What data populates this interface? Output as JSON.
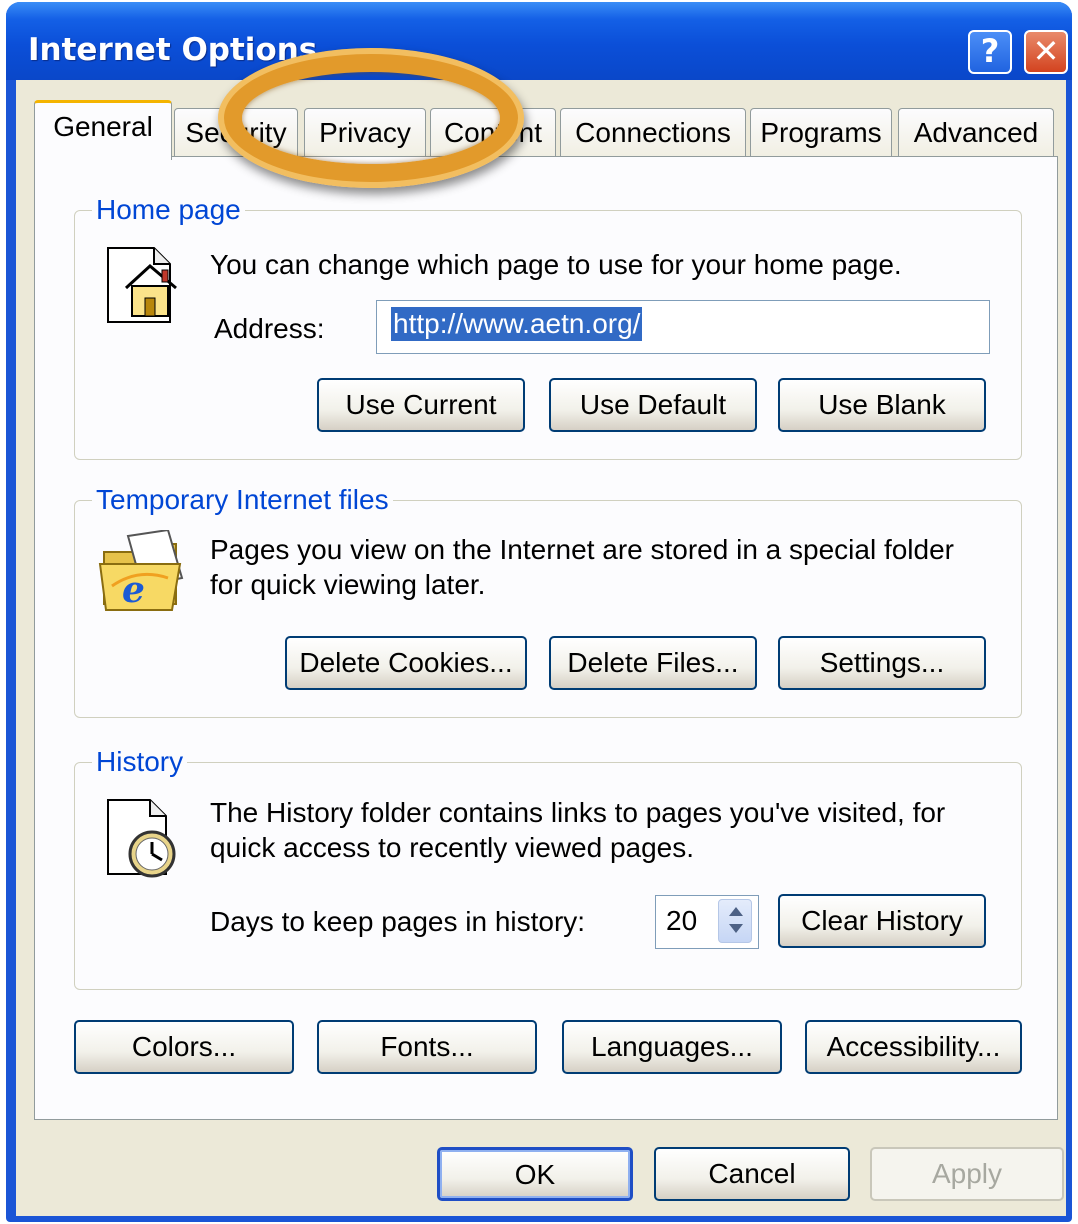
{
  "window": {
    "title": "Internet Options",
    "help_glyph": "?",
    "close_glyph": "✕"
  },
  "tabs": [
    {
      "label": "General",
      "active": true
    },
    {
      "label": "Security",
      "active": false
    },
    {
      "label": "Privacy",
      "active": false
    },
    {
      "label": "Content",
      "active": false
    },
    {
      "label": "Connections",
      "active": false
    },
    {
      "label": "Programs",
      "active": false
    },
    {
      "label": "Advanced",
      "active": false
    }
  ],
  "home_page": {
    "title": "Home page",
    "description": "You can change which page to use for your home page.",
    "address_label": "Address:",
    "address_value": "http://www.aetn.org/",
    "buttons": [
      "Use Current",
      "Use Default",
      "Use Blank"
    ]
  },
  "temp_files": {
    "title": "Temporary Internet files",
    "description_line1": "Pages you view on the Internet are stored in a special folder",
    "description_line2": "for quick viewing later.",
    "buttons": [
      "Delete Cookies...",
      "Delete Files...",
      "Settings..."
    ]
  },
  "history": {
    "title": "History",
    "description_line1": "The History folder contains links to pages you've visited, for",
    "description_line2": "quick access to recently viewed pages.",
    "days_label": "Days to keep pages in history:",
    "days_value": "20",
    "clear_button": "Clear History"
  },
  "bottom_buttons": [
    "Colors...",
    "Fonts...",
    "Languages...",
    "Accessibility..."
  ],
  "dialog_buttons": {
    "ok": "OK",
    "cancel": "Cancel",
    "apply": "Apply"
  },
  "colors": {
    "titlebar": "#0a47c9",
    "group_title": "#0046d5",
    "highlight_ring": "#e29a2b",
    "selection": "#316ac5"
  }
}
